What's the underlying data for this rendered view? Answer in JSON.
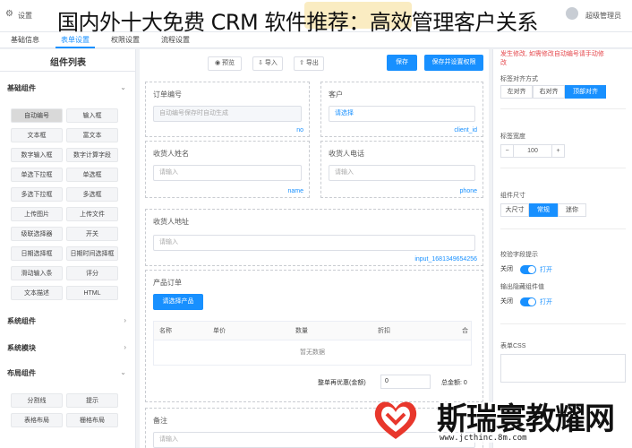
{
  "header": {
    "settings_label": "设置",
    "headline": "国内外十大免费 CRM 软件推荐：高效管理客户关系",
    "advanced_label": "超级管理员"
  },
  "tabs": [
    "基础信息",
    "表单设置",
    "权限设置",
    "流程设置"
  ],
  "left_panel": {
    "title": "组件列表",
    "basic_group": "基础组件",
    "components": [
      "自动编号",
      "输入框",
      "文本框",
      "富文本",
      "数字输入框",
      "数字计算字段",
      "单选下拉框",
      "单选框",
      "多选下拉框",
      "多选框",
      "上传图片",
      "上传文件",
      "级联选择器",
      "开关",
      "日期选择框",
      "日期时间选择框",
      "滑动输入条",
      "评分",
      "文本描述",
      "HTML"
    ],
    "system_group": "系统组件",
    "module_group": "系统模块",
    "layout_group": "布局组件",
    "layout_components": [
      "分割线",
      "提示",
      "表格布局",
      "栅格布局"
    ]
  },
  "toolbar": {
    "preview": "预览",
    "import": "导入",
    "export": "导出",
    "save": "保存",
    "save_permissions": "保存并设置权限"
  },
  "form": {
    "order_no_label": "订单编号",
    "order_no_placeholder": "自动编号保存时自动生成",
    "order_no_key": "no",
    "customer_label": "客户",
    "customer_placeholder": "请选择",
    "customer_key": "client_id",
    "receiver_name_label": "收货人姓名",
    "receiver_name_placeholder": "请输入",
    "receiver_name_key": "name",
    "receiver_phone_label": "收货人电话",
    "receiver_phone_placeholder": "请输入",
    "receiver_phone_key": "phone",
    "address_label": "收货人地址",
    "address_placeholder": "请输入",
    "address_key": "input_1681349654256",
    "product_order_label": "产品订单",
    "select_product_button": "请选择产品",
    "table_columns": [
      "名称",
      "单价",
      "数量",
      "折扣",
      "合"
    ],
    "table_empty": "暂无数据",
    "discount_label": "整单再优惠(金额)",
    "discount_value": "0",
    "total_label": "总金额: 0",
    "remark_label": "备注",
    "remark_placeholder": "请输入"
  },
  "right_panel": {
    "warning_line1": "发生修改, 如需修改自动编号请手动修",
    "warning_line2": "改",
    "label_align_title": "标签对齐方式",
    "label_align_options": [
      "左对齐",
      "右对齐",
      "顶部对齐"
    ],
    "label_width_title": "标签宽度",
    "label_width_minus": "−",
    "label_width_value": "100",
    "label_width_plus": "+",
    "size_title": "组件尺寸",
    "size_options": [
      "大尺寸",
      "常规",
      "迷你"
    ],
    "validation_title": "校验字段提示",
    "off_label": "关闭",
    "on_label": "打开",
    "output_hidden_title": "输出隐藏组件值",
    "form_css_title": "表单CSS"
  },
  "watermark": {
    "text": "斯瑞寰教耀网",
    "url": "www.jcthinc.8m.com"
  },
  "colors": {
    "accent": "#1890ff",
    "warning": "#e5484d"
  }
}
